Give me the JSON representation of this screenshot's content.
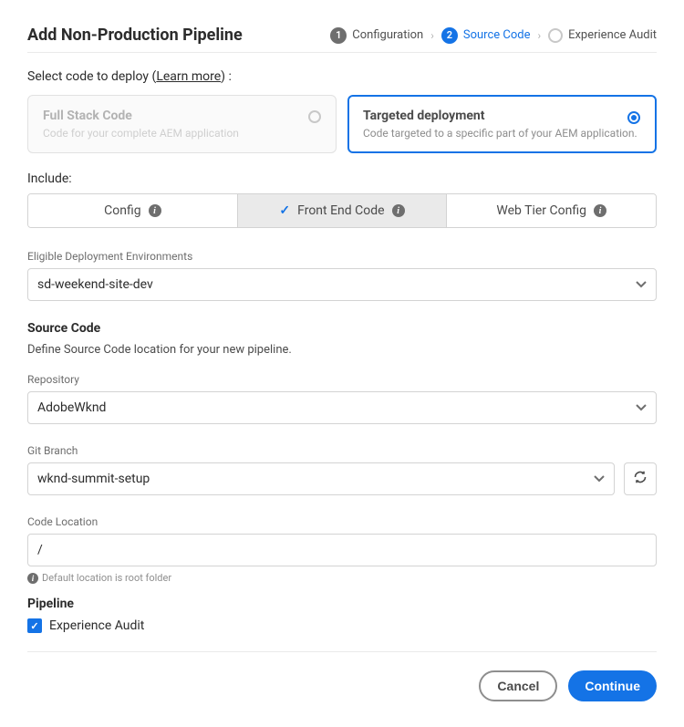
{
  "header": {
    "title": "Add Non-Production Pipeline",
    "steps": [
      {
        "num": "1",
        "label": "Configuration"
      },
      {
        "num": "2",
        "label": "Source Code"
      },
      {
        "num": "",
        "label": "Experience Audit"
      }
    ]
  },
  "deploy": {
    "prompt_prefix": "Select code to deploy  (",
    "learn_more": "Learn more",
    "prompt_suffix": ") :",
    "options": [
      {
        "title": "Full Stack Code",
        "desc": "Code for your complete AEM application"
      },
      {
        "title": "Targeted deployment",
        "desc": "Code targeted to a specific part of your AEM application."
      }
    ]
  },
  "include": {
    "label": "Include:",
    "items": [
      "Config",
      "Front End Code",
      "Web Tier Config"
    ]
  },
  "env": {
    "label": "Eligible Deployment Environments",
    "value": "sd-weekend-site-dev"
  },
  "source": {
    "title": "Source Code",
    "desc": "Define Source Code location for your new pipeline.",
    "repo_label": "Repository",
    "repo_value": "AdobeWknd",
    "branch_label": "Git Branch",
    "branch_value": "wknd-summit-setup",
    "loc_label": "Code Location",
    "loc_value": "/",
    "loc_hint": "Default location is root folder"
  },
  "pipeline": {
    "title": "Pipeline",
    "audit_label": "Experience Audit"
  },
  "footer": {
    "cancel": "Cancel",
    "continue": "Continue"
  },
  "icons": {
    "info": "i",
    "check": "✓"
  }
}
